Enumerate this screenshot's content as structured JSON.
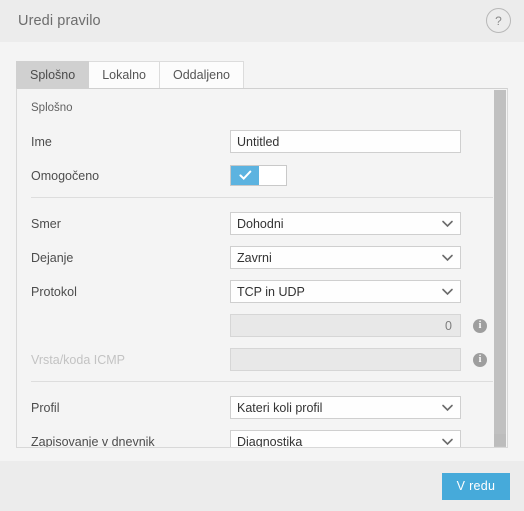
{
  "window": {
    "title": "Uredi pravilo",
    "help_icon": "question-mark-icon",
    "help_label": "?"
  },
  "tabs": [
    {
      "label": "Splošno",
      "active": true
    },
    {
      "label": "Lokalno",
      "active": false
    },
    {
      "label": "Oddaljeno",
      "active": false
    }
  ],
  "panel": {
    "section_title": "Splošno",
    "fields": {
      "name": {
        "label": "Ime",
        "value": "Untitled",
        "placeholder": ""
      },
      "enabled": {
        "label": "Omogočeno",
        "state": "on",
        "check_icon": "check-icon"
      },
      "direction": {
        "label": "Smer",
        "value": "Dohodni"
      },
      "action": {
        "label": "Dejanje",
        "value": "Zavrni"
      },
      "protocol": {
        "label": "Protokol",
        "value": "TCP in UDP"
      },
      "protocol_number": {
        "label": "",
        "value": "0",
        "disabled": true,
        "info_icon": "info-icon"
      },
      "icmp": {
        "label": "Vrsta/koda ICMP",
        "value": "",
        "disabled": true,
        "info_icon": "info-icon"
      },
      "profile": {
        "label": "Profil",
        "value": "Kateri koli profil"
      },
      "logging": {
        "label": "Zapisovanje v dnevnik",
        "value": "Diagnostika"
      }
    },
    "dropdown_icon": "chevron-down-icon"
  },
  "scrollbar": {
    "thumb_name": "vertical-scroll-thumb",
    "button_name": "scroll-down-button"
  },
  "footer": {
    "ok_label": "V redu"
  },
  "colors": {
    "accent": "#46aada",
    "toggle_on": "#5cb3e0",
    "header_bg": "#ececec",
    "panel_bg": "#f4f4f4",
    "active_tab_bg": "#d0d0d0",
    "info_icon": "#9e9e9e"
  }
}
